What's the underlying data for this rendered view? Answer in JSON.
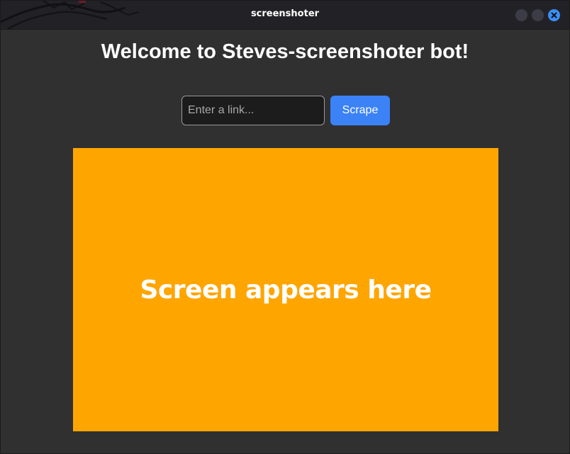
{
  "window": {
    "title": "screenshoter",
    "buttons": {
      "minimize_color": "#3c3c46",
      "maximize_color": "#3c3c46",
      "close_color": "#3a8ff5"
    }
  },
  "main": {
    "heading": "Welcome to Steves-screenshoter bot!",
    "link_input": {
      "placeholder": "Enter a link...",
      "value": ""
    },
    "scrape_button": {
      "label": "Scrape",
      "color": "#3b82f6"
    },
    "screen_area": {
      "placeholder_text": "Screen appears here",
      "background_color": "#ffa500"
    }
  }
}
